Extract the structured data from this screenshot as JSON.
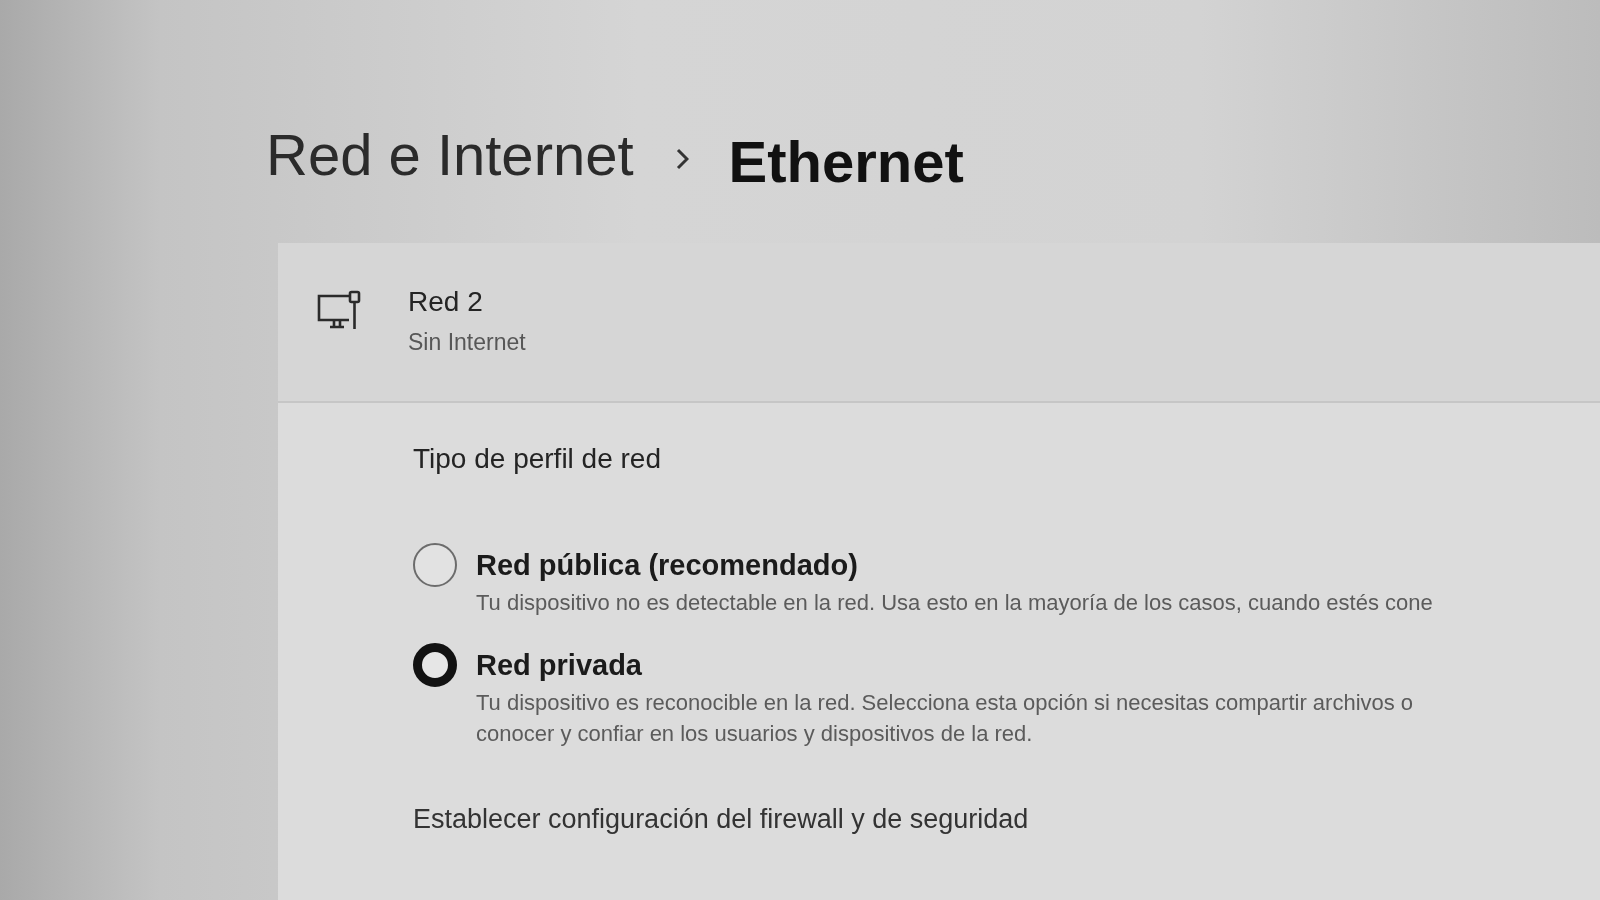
{
  "breadcrumb": [
    {
      "label": "Red e Internet",
      "current": false
    },
    {
      "label": "Ethernet",
      "current": true
    }
  ],
  "connection": {
    "name": "Red 2",
    "status": "Sin Internet"
  },
  "network_profile": {
    "title": "Tipo de perfil de red",
    "options": [
      {
        "label": "Red pública (recomendado)",
        "description": [
          "Tu dispositivo no es detectable en la red. Usa esto en la mayoría de los casos, cuando estés cone"
        ],
        "selected": false
      },
      {
        "label": "Red privada",
        "description": [
          "Tu dispositivo es reconocible en la red. Selecciona esta opción si necesitas compartir archivos o",
          "conocer y confiar en los usuarios y dispositivos de la red."
        ],
        "selected": true
      }
    ]
  },
  "firewall_link": "Establecer configuración del firewall y de seguridad"
}
